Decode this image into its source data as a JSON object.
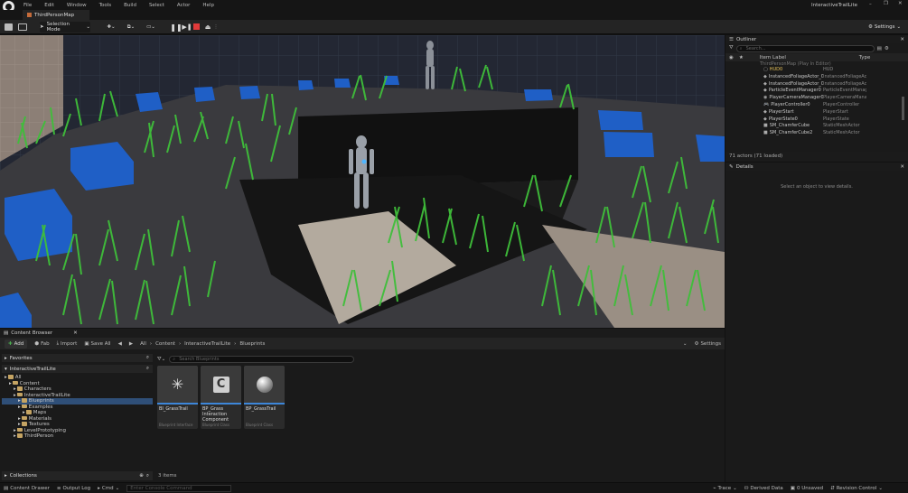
{
  "menu": [
    "File",
    "Edit",
    "Window",
    "Tools",
    "Build",
    "Select",
    "Actor",
    "Help"
  ],
  "window_title": "InteractiveTrailLite",
  "tab": "ThirdPersonMap",
  "toolbar": {
    "selection_mode": "Selection Mode",
    "settings": "Settings"
  },
  "content_browser": {
    "title": "Content Browser",
    "add": "Add",
    "fab": "Fab",
    "import": "Import",
    "save_all": "Save All",
    "breadcrumb": [
      "All",
      "Content",
      "InteractiveTrailLite",
      "Blueprints"
    ],
    "settings": "Settings",
    "favorites": "Favorites",
    "project": "InteractiveTrailLite",
    "search_placeholder": "Search Blueprints",
    "tree": [
      {
        "label": "All",
        "indent": 0
      },
      {
        "label": "Content",
        "indent": 1
      },
      {
        "label": "Characters",
        "indent": 2
      },
      {
        "label": "InteractiveTrailLite",
        "indent": 2
      },
      {
        "label": "Blueprints",
        "indent": 3,
        "selected": true
      },
      {
        "label": "Examples",
        "indent": 3
      },
      {
        "label": "Maps",
        "indent": 4
      },
      {
        "label": "Materials",
        "indent": 3
      },
      {
        "label": "Textures",
        "indent": 3
      },
      {
        "label": "LevelPrototyping",
        "indent": 2
      },
      {
        "label": "ThirdPerson",
        "indent": 2
      }
    ],
    "assets": [
      {
        "name": "BI_GrassTrail",
        "type": "Blueprint Interface",
        "icon": "interface"
      },
      {
        "name": "BP_Grass Interaction Component",
        "type": "Blueprint Class",
        "icon": "component"
      },
      {
        "name": "BP_GrassTrail",
        "type": "Blueprint Class",
        "icon": "sphere"
      }
    ],
    "collections": "Collections",
    "item_count": "3 items"
  },
  "outliner": {
    "title": "Outliner",
    "search_placeholder": "Search...",
    "col_label": "Item Label",
    "col_type": "Type",
    "root": "ThirdPersonMap (Play In Editor)",
    "rows": [
      {
        "label": "HUD0",
        "type": "HUD",
        "icon": "hud"
      },
      {
        "label": "InstancedFoliageActor_0_-1_0",
        "type": "InstancedFoliageActor",
        "icon": "actor"
      },
      {
        "label": "InstancedFoliageActor_0_0_0",
        "type": "InstancedFoliageActor",
        "icon": "actor"
      },
      {
        "label": "ParticleEventManager0",
        "type": "ParticleEventManager",
        "icon": "actor"
      },
      {
        "label": "PlayerCameraManager0",
        "type": "PlayerCameraManager",
        "icon": "camera"
      },
      {
        "label": "PlayerController0",
        "type": "PlayerController",
        "icon": "gamepad"
      },
      {
        "label": "PlayerStart",
        "type": "PlayerStart",
        "icon": "actor"
      },
      {
        "label": "PlayerState0",
        "type": "PlayerState",
        "icon": "actor"
      },
      {
        "label": "SM_ChamferCube",
        "type": "StaticMeshActor",
        "icon": "cube"
      },
      {
        "label": "SM_ChamferCube2",
        "type": "StaticMeshActor",
        "icon": "cube"
      }
    ],
    "footer": "71 actors (71 loaded)"
  },
  "details": {
    "title": "Details",
    "hint": "Select an object to view details."
  },
  "statusbar": {
    "content_drawer": "Content Drawer",
    "output_log": "Output Log",
    "cmd": "Cmd",
    "console_placeholder": "Enter Console Command",
    "trace": "Trace",
    "derived_data": "Derived Data",
    "unsaved": "0 Unsaved",
    "revision_control": "Revision Control"
  },
  "colors": {
    "accent": "#3d86d9",
    "folder": "#c5a463",
    "bg": "#1a1a1a"
  }
}
